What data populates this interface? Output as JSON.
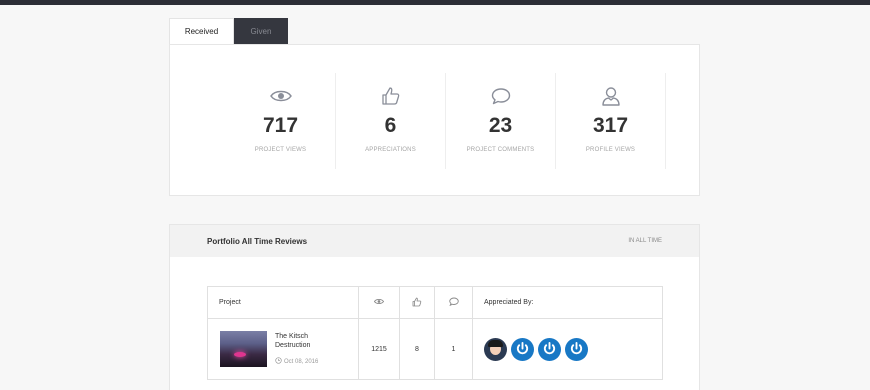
{
  "tabs": [
    {
      "label": "Received"
    },
    {
      "label": "Given"
    }
  ],
  "stats": [
    {
      "icon": "eye-icon",
      "value": "717",
      "label": "PROJECT VIEWS"
    },
    {
      "icon": "thumbs-up-icon",
      "value": "6",
      "label": "APPRECIATIONS"
    },
    {
      "icon": "comment-icon",
      "value": "23",
      "label": "PROJECT COMMENTS"
    },
    {
      "icon": "user-icon",
      "value": "317",
      "label": "PROFILE VIEWS"
    }
  ],
  "reviews": {
    "title": "Portfolio All Time Reviews",
    "range": "IN ALL TIME",
    "columns": {
      "project": "Project",
      "views_icon": "eye-icon",
      "appreciations_icon": "thumbs-up-icon",
      "comments_icon": "comment-icon",
      "appreciated_by": "Appreciated By:"
    },
    "rows": [
      {
        "name": "The Kitsch Destruction",
        "date": "Oct 08, 2016",
        "views": "1215",
        "appreciations": "8",
        "comments": "1"
      }
    ]
  },
  "colors": {
    "accent": "#1878c5",
    "dark_tab": "#35373f",
    "topbar": "#2c2e36"
  }
}
